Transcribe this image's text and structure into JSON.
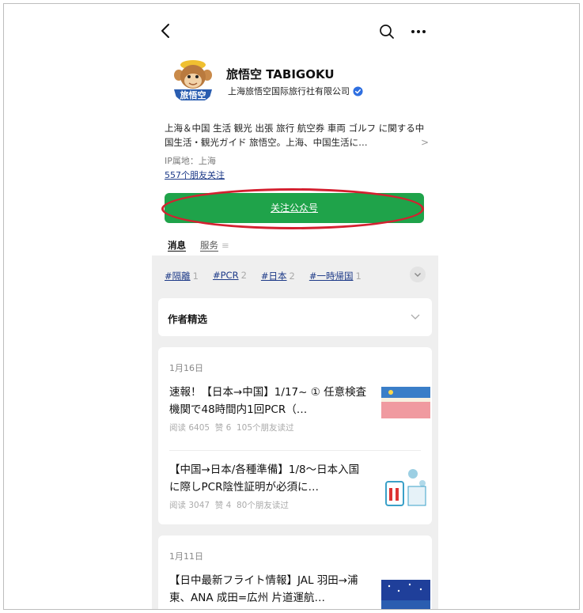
{
  "header": {
    "back_icon": "chevron-left-icon",
    "search_icon": "search-icon",
    "more_icon": "more-dots-icon"
  },
  "profile": {
    "avatar_text": "旅悟空",
    "name": "旅悟空 TABIGOKU",
    "organization": "上海旅悟空国际旅行社有限公司",
    "verified_icon": "verified-badge-icon",
    "description": "上海＆中国 生活 観光 出張 旅行 航空券 車両 ゴルフ に関する中国生活・観光ガイド 旅悟空。上海、中国生活に…",
    "ip_location": "IP属地：上海",
    "friends_following": "557个朋友关注",
    "follow_button": "关注公众号"
  },
  "tabs": [
    {
      "label": "消息",
      "active": true
    },
    {
      "label": "服务",
      "active": false
    }
  ],
  "tags": [
    {
      "label": "#隔離",
      "count": "1"
    },
    {
      "label": "#PCR",
      "count": "2"
    },
    {
      "label": "#日本",
      "count": "2"
    },
    {
      "label": "#一時帰国",
      "count": "1"
    }
  ],
  "featured": {
    "title": "作者精选"
  },
  "groups": [
    {
      "date": "1月16日",
      "articles": [
        {
          "title": "速報！【日本→中国】1/17~ ① 任意検査機関で48時間内1回PCR（…",
          "reads": "阅读 6405",
          "likes": "赞 6",
          "friends_read": "105个朋友读过"
        },
        {
          "title": "【中国→日本/各種準備】1/8～日本入国に際しPCR陰性証明が必須に…",
          "reads": "阅读 3047",
          "likes": "赞 4",
          "friends_read": "80个朋友读过"
        }
      ]
    },
    {
      "date": "1月11日",
      "articles": [
        {
          "title": "【日中最新フライト情報】JAL 羽田→浦東、ANA 成田=広州 片道運航…",
          "reads": "",
          "likes": "",
          "friends_read": ""
        }
      ]
    }
  ],
  "colors": {
    "follow_green": "#1fa34a",
    "annotation_red": "#d42030",
    "link_blue": "#1d3a88",
    "verified_blue": "#2f6fe0"
  }
}
